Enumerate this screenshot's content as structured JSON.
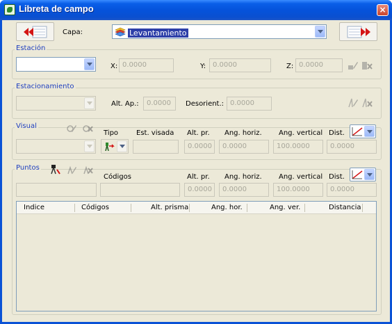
{
  "window": {
    "title": "Libreta de campo",
    "close_label": "×"
  },
  "capa": {
    "label": "Capa:",
    "value": "Levantamiento"
  },
  "estacion": {
    "title": "Estación",
    "x_label": "X:",
    "x_value": "0.0000",
    "y_label": "Y:",
    "y_value": "0.0000",
    "z_label": "Z:",
    "z_value": "0.0000"
  },
  "estacionamiento": {
    "title": "Estacionamiento",
    "alt_ap_label": "Alt. Ap.:",
    "alt_ap_value": "0.0000",
    "desorient_label": "Desorient.:",
    "desorient_value": "0.0000"
  },
  "visual": {
    "title": "Visual",
    "tipo_label": "Tipo",
    "est_visada_label": "Est. visada",
    "alt_pr_label": "Alt. pr.",
    "alt_pr_value": "0.0000",
    "ang_horiz_label": "Ang. horiz.",
    "ang_horiz_value": "0.0000",
    "ang_vertical_label": "Ang. vertical",
    "ang_vertical_value": "100.0000",
    "dist_label": "Dist.",
    "dist_value": "0.0000"
  },
  "puntos": {
    "title": "Puntos",
    "codigos_label": "Códigos",
    "alt_pr_label": "Alt. pr.",
    "alt_pr_value": "0.0000",
    "ang_horiz_label": "Ang. horiz.",
    "ang_horiz_value": "0.0000",
    "ang_vertical_label": "Ang. vertical",
    "ang_vertical_value": "100.0000",
    "dist_label": "Dist.",
    "dist_value": "0.0000"
  },
  "table": {
    "columns": [
      "Indice",
      "Códigos",
      "Alt. prisma",
      "Ang. hor.",
      "Ang. ver.",
      "Distancia"
    ],
    "rows": []
  },
  "colors": {
    "title_bar": "#0553db",
    "dialog_bg": "#ece9d8",
    "group_label": "#1f3fbf",
    "nav_arrow": "#d41515"
  }
}
